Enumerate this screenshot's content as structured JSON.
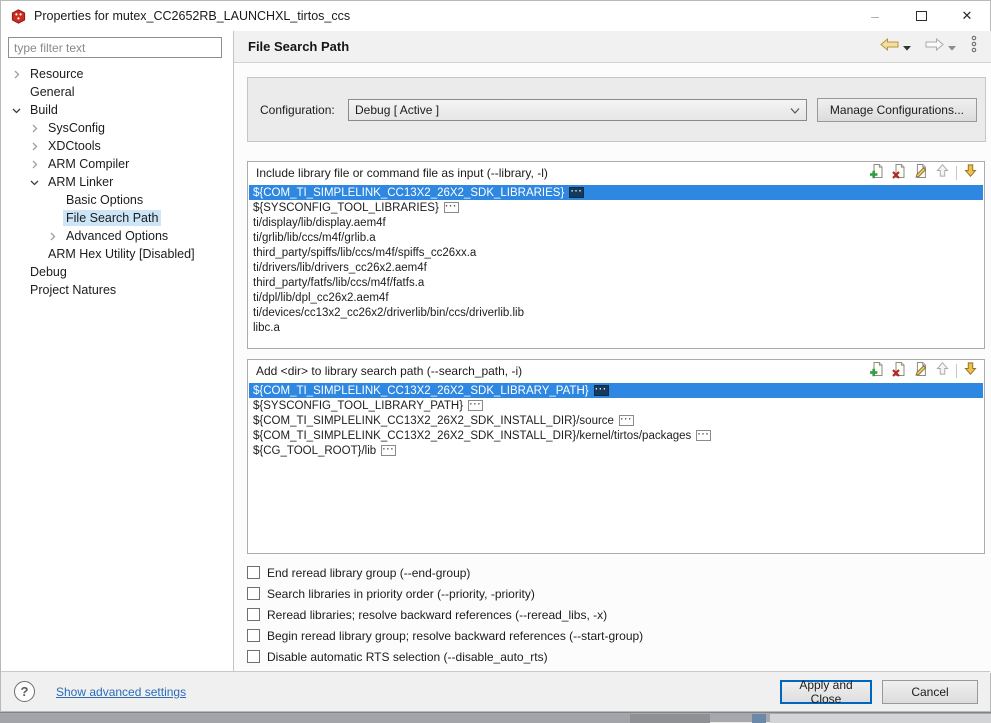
{
  "window": {
    "title": "Properties for mutex_CC2652RB_LAUNCHXL_tirtos_ccs"
  },
  "sidebar": {
    "filter_placeholder": "type filter text",
    "tree": [
      {
        "label": "Resource",
        "state": "collapsed",
        "indent": 0
      },
      {
        "label": "General",
        "state": "leaf",
        "indent": 0
      },
      {
        "label": "Build",
        "state": "expanded",
        "indent": 0
      },
      {
        "label": "SysConfig",
        "state": "collapsed",
        "indent": 1
      },
      {
        "label": "XDCtools",
        "state": "collapsed",
        "indent": 1
      },
      {
        "label": "ARM Compiler",
        "state": "collapsed",
        "indent": 1
      },
      {
        "label": "ARM Linker",
        "state": "expanded",
        "indent": 1
      },
      {
        "label": "Basic Options",
        "state": "leaf",
        "indent": 2
      },
      {
        "label": "File Search Path",
        "state": "leaf",
        "indent": 2,
        "selected": true
      },
      {
        "label": "Advanced Options",
        "state": "collapsed",
        "indent": 2
      },
      {
        "label": "ARM Hex Utility [Disabled]",
        "state": "leaf",
        "indent": 1
      },
      {
        "label": "Debug",
        "state": "leaf",
        "indent": 0
      },
      {
        "label": "Project Natures",
        "state": "leaf",
        "indent": 0
      }
    ]
  },
  "header": {
    "title": "File Search Path"
  },
  "config": {
    "label": "Configuration:",
    "selected": "Debug [ Active ]",
    "manage_label": "Manage Configurations..."
  },
  "lists": [
    {
      "title": "Include library file or command file as input (--library, -l)",
      "items": [
        {
          "text": "${COM_TI_SIMPLELINK_CC13X2_26X2_SDK_LIBRARIES}",
          "badge": true,
          "selected": true
        },
        {
          "text": "${SYSCONFIG_TOOL_LIBRARIES}",
          "badge": true
        },
        {
          "text": "ti/display/lib/display.aem4f"
        },
        {
          "text": "ti/grlib/lib/ccs/m4f/grlib.a"
        },
        {
          "text": "third_party/spiffs/lib/ccs/m4f/spiffs_cc26xx.a"
        },
        {
          "text": "ti/drivers/lib/drivers_cc26x2.aem4f"
        },
        {
          "text": "third_party/fatfs/lib/ccs/m4f/fatfs.a"
        },
        {
          "text": "ti/dpl/lib/dpl_cc26x2.aem4f"
        },
        {
          "text": "ti/devices/cc13x2_cc26x2/driverlib/bin/ccs/driverlib.lib"
        },
        {
          "text": "libc.a"
        }
      ]
    },
    {
      "title": "Add <dir> to library search path (--search_path, -i)",
      "items": [
        {
          "text": "${COM_TI_SIMPLELINK_CC13X2_26X2_SDK_LIBRARY_PATH}",
          "badge": true,
          "selected": true
        },
        {
          "text": "${SYSCONFIG_TOOL_LIBRARY_PATH}",
          "badge": true
        },
        {
          "text": "${COM_TI_SIMPLELINK_CC13X2_26X2_SDK_INSTALL_DIR}/source",
          "badge": true
        },
        {
          "text": "${COM_TI_SIMPLELINK_CC13X2_26X2_SDK_INSTALL_DIR}/kernel/tirtos/packages",
          "badge": true
        },
        {
          "text": "${CG_TOOL_ROOT}/lib",
          "badge": true
        }
      ]
    }
  ],
  "checkboxes": [
    {
      "label": "End reread library group (--end-group)",
      "checked": false
    },
    {
      "label": "Search libraries in priority order (--priority, -priority)",
      "checked": false
    },
    {
      "label": "Reread libraries; resolve backward references (--reread_libs, -x)",
      "checked": false
    },
    {
      "label": "Begin reread library group; resolve backward references (--start-group)",
      "checked": false
    },
    {
      "label": "Disable automatic RTS selection (--disable_auto_rts)",
      "checked": false
    }
  ],
  "footer": {
    "advanced_link": "Show advanced settings",
    "apply_label": "Apply and Close",
    "cancel_label": "Cancel"
  },
  "icons": {
    "ellipsis_badge": "···",
    "help": "?",
    "minimize": "–",
    "close": "✕"
  },
  "colors": {
    "selection": "#2e87e0",
    "selection_text": "#ffffff",
    "tree_sel": "#cde6f7",
    "link": "#2b6cb8",
    "accent_border": "#0067c0"
  }
}
